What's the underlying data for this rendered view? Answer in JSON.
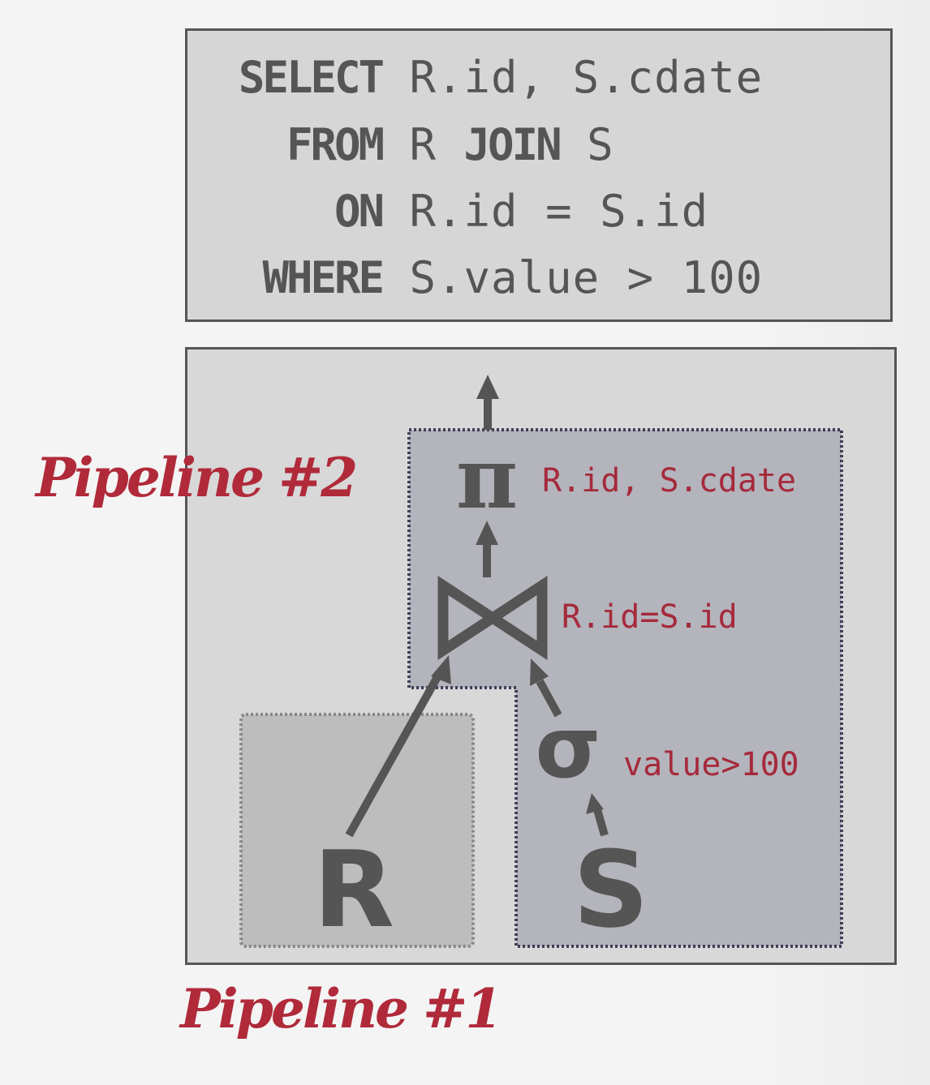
{
  "query": {
    "lines": [
      {
        "keyword": "SELECT",
        "rest": " R.id, S.cdate"
      },
      {
        "keyword": "FROM",
        "rest": " R ",
        "keyword2": "JOIN",
        "rest2": " S"
      },
      {
        "keyword": "ON",
        "rest": " R.id = S.id"
      },
      {
        "keyword": "WHERE",
        "rest": " S.value > 100"
      }
    ]
  },
  "plan": {
    "projection": {
      "symbol": "π",
      "annotation": "R.id, S.cdate"
    },
    "join": {
      "symbol": "⋈",
      "annotation": "R.id=S.id"
    },
    "selection": {
      "symbol": "σ",
      "annotation": "value>100"
    },
    "relations": {
      "left": "R",
      "right": "S"
    }
  },
  "pipelines": {
    "pipeline_2": "Pipeline #2",
    "pipeline_1": "Pipeline #1"
  },
  "colors": {
    "accent": "#b02a3a",
    "operator": "#555555",
    "pipeline2_fill": "#b4b4bc",
    "pipeline1_fill": "#bdbdbd"
  }
}
